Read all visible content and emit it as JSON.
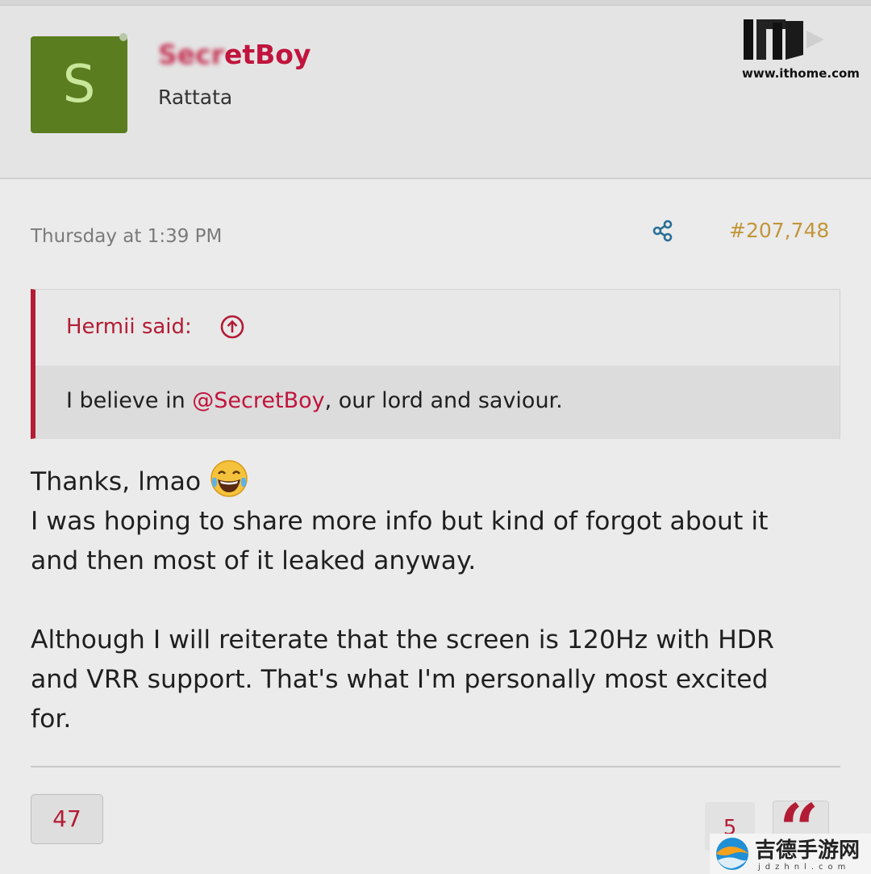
{
  "header": {
    "avatar_letter": "S",
    "username_obscured": "Secr",
    "username_visible": "etBoy",
    "user_title": "Rattata"
  },
  "watermark": {
    "logo_icon": "ithome-logo-icon",
    "url": "www.ithome.com"
  },
  "post": {
    "time": "Thursday at 1:39 PM",
    "share_icon": "share-icon",
    "number": "#207,748"
  },
  "quote": {
    "author": "Hermii said:",
    "jump_icon": "arrow-up-circle-icon",
    "text_before": "I believe in ",
    "mention": "@SecretBoy",
    "text_after": ", our lord and saviour."
  },
  "message": {
    "line1": "Thanks, lmao",
    "emoji": "laughing-tears-emoji-icon",
    "line2": "I was hoping to share more info but kind of forgot about it",
    "line3": "and then most of it leaked anyway.",
    "line4": "Although I will reiterate that the screen is 120Hz with HDR",
    "line5": "and VRR support. That's what I'm personally most excited",
    "line6": "for."
  },
  "footer": {
    "reaction_count": "47",
    "secondary_count": "5",
    "reply_icon": "quote-mark-icon"
  },
  "watermark2": {
    "text": "吉德手游网",
    "sub": "jdzhnl.com"
  },
  "colors": {
    "accent": "#b31c35",
    "username": "#c0143c",
    "post_number": "#c2963a",
    "share_icon": "#2a6f97",
    "avatar_bg": "#5a7d1f"
  }
}
